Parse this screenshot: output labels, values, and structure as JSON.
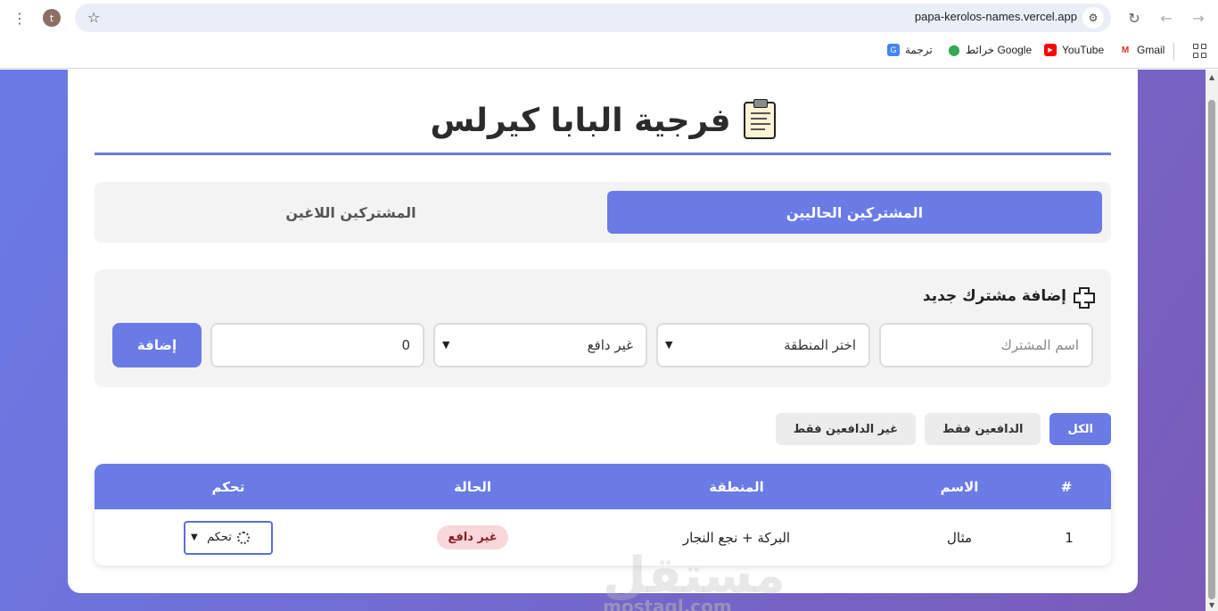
{
  "browser": {
    "url": "papa-kerolos-names.vercel.app",
    "profile_initial": "t",
    "bookmarks": [
      {
        "label": "Gmail",
        "icon": "gmail-icon"
      },
      {
        "label": "YouTube",
        "icon": "youtube-icon"
      },
      {
        "label": "خرائط Google",
        "icon": "maps-icon"
      },
      {
        "label": "ترجمة",
        "icon": "translate-icon"
      }
    ]
  },
  "page": {
    "title": "فرجية البابا كيرلس",
    "tabs": {
      "current": "المشتركين الحاليين",
      "cancelled": "المشتركين اللاغين"
    },
    "add_form": {
      "title": "إضافة مشترك جديد",
      "name_placeholder": "اسم المشترك",
      "region_value": "اختر المنطقة",
      "status_value": "غير دافع",
      "amount_value": "0",
      "submit_label": "إضافة"
    },
    "filters": {
      "all": "الكل",
      "paid_only": "الدافعين فقط",
      "unpaid_only": "غير الدافعين فقط"
    },
    "table": {
      "headers": {
        "num": "#",
        "name": "الاسم",
        "region": "المنطقة",
        "status": "الحالة",
        "control": "تحكم"
      },
      "rows": [
        {
          "num": "1",
          "name": "مثال",
          "region": "البركة + نجع النجار",
          "status": "غير دافع",
          "control": "تحكم"
        }
      ]
    },
    "watermark": {
      "arabic": "مستقل",
      "latin": "mostaql.com"
    },
    "colors": {
      "accent": "#6a7be6",
      "unpaid_badge_bg": "#f8d7da",
      "unpaid_badge_text": "#8a1c24"
    }
  }
}
